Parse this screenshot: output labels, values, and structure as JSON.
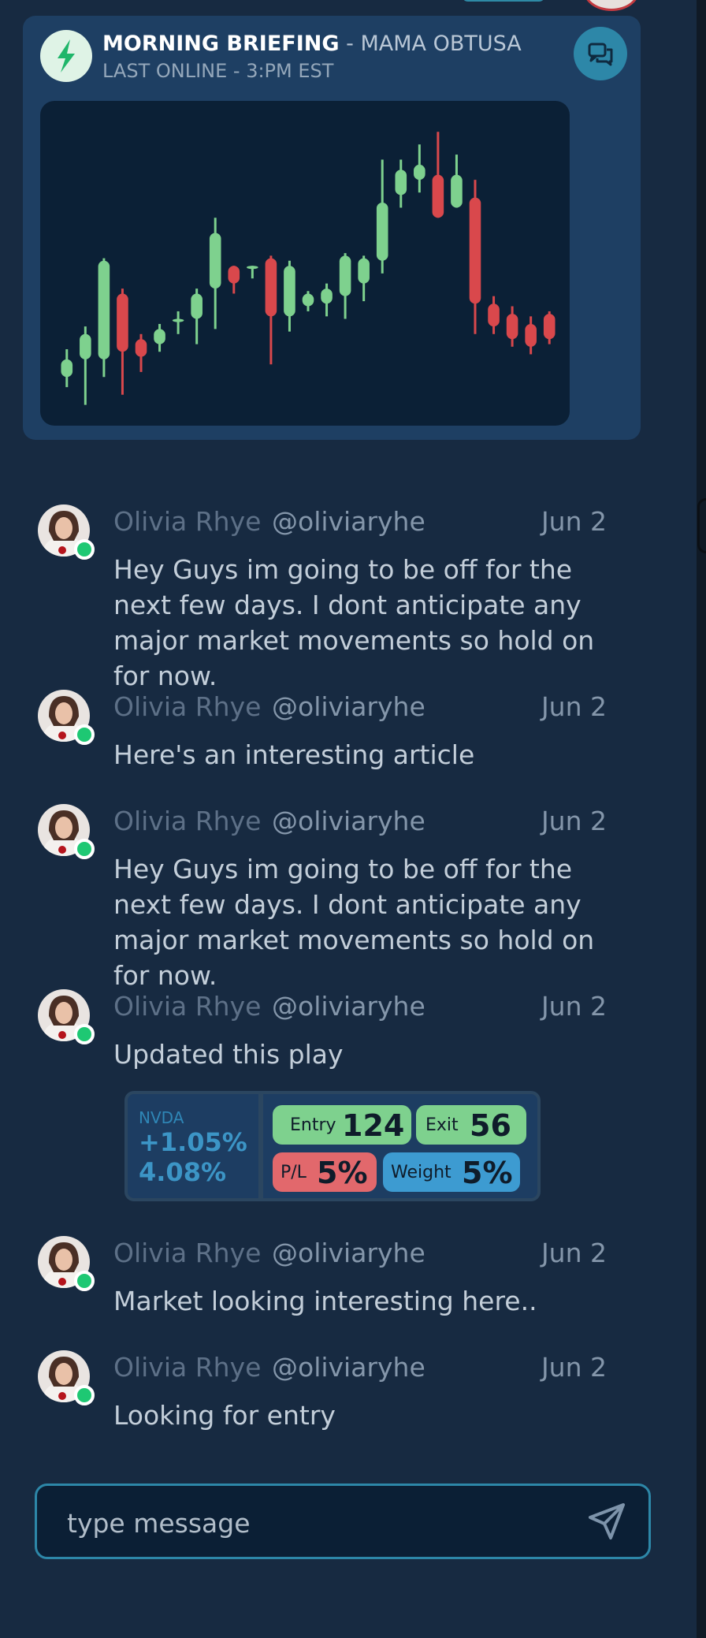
{
  "briefing": {
    "title": "MORNING BRIEFING",
    "separator": " - ",
    "author": "MAMA OBTUSA",
    "last_online": "LAST ONLINE - 3:PM EST",
    "icons": {
      "logo": "lightning-bolt-icon",
      "chat": "chat-bubbles-icon"
    },
    "colors": {
      "up": "#7ed18e",
      "down": "#d9484c",
      "panel": "#0b2036"
    }
  },
  "chart_data": {
    "type": "candlestick",
    "candles": [
      {
        "o": 5,
        "c": 12,
        "h": 16,
        "l": 1
      },
      {
        "o": 12,
        "c": 22,
        "h": 25,
        "l": -6
      },
      {
        "o": 12,
        "c": 51,
        "h": 52,
        "l": 5
      },
      {
        "o": 38,
        "c": 15,
        "h": 40,
        "l": -2
      },
      {
        "o": 20,
        "c": 13,
        "h": 22,
        "l": 7
      },
      {
        "o": 18,
        "c": 24,
        "h": 26,
        "l": 15
      },
      {
        "o": 28,
        "c": 28,
        "h": 31,
        "l": 22
      },
      {
        "o": 28,
        "c": 38,
        "h": 40,
        "l": 18
      },
      {
        "o": 40,
        "c": 62,
        "h": 68,
        "l": 24
      },
      {
        "o": 49,
        "c": 42,
        "h": 49,
        "l": 38
      },
      {
        "o": 49,
        "c": 49,
        "h": 49,
        "l": 44
      },
      {
        "o": 52,
        "c": 29,
        "h": 53,
        "l": 10
      },
      {
        "o": 29,
        "c": 49,
        "h": 51,
        "l": 23
      },
      {
        "o": 33,
        "c": 38,
        "h": 39,
        "l": 31
      },
      {
        "o": 34,
        "c": 40,
        "h": 42,
        "l": 29
      },
      {
        "o": 37,
        "c": 53,
        "h": 54,
        "l": 28
      },
      {
        "o": 42,
        "c": 52,
        "h": 53,
        "l": 35
      },
      {
        "o": 51,
        "c": 74,
        "h": 91,
        "l": 46
      },
      {
        "o": 77,
        "c": 87,
        "h": 91,
        "l": 72
      },
      {
        "o": 83,
        "c": 89,
        "h": 97,
        "l": 78
      },
      {
        "o": 85,
        "c": 68,
        "h": 102,
        "l": 68
      },
      {
        "o": 72,
        "c": 85,
        "h": 93,
        "l": 72
      },
      {
        "o": 76,
        "c": 34,
        "h": 83,
        "l": 22
      },
      {
        "o": 34,
        "c": 25,
        "h": 37,
        "l": 22
      },
      {
        "o": 30,
        "c": 20,
        "h": 33,
        "l": 17
      },
      {
        "o": 26,
        "c": 17,
        "h": 29,
        "l": 14
      },
      {
        "o": 30,
        "c": 20,
        "h": 31,
        "l": 18
      }
    ],
    "ylim": [
      -8,
      108
    ],
    "grid": false
  },
  "messages": [
    {
      "name": "Olivia Rhye",
      "handle": "@oliviaryhe",
      "date": "Jun 2",
      "text": "Hey Guys im going to be off for the next few days. I dont anticipate any major market movements so hold on for now."
    },
    {
      "name": "Olivia Rhye",
      "handle": "@oliviaryhe",
      "date": "Jun 2",
      "text": "Here's an interesting article"
    },
    {
      "name": "Olivia Rhye",
      "handle": "@oliviaryhe",
      "date": "Jun 2",
      "text": "Hey Guys im going to be off for the next few days. I dont anticipate any major market movements so hold on for now."
    },
    {
      "name": "Olivia Rhye",
      "handle": "@oliviaryhe",
      "date": "Jun 2",
      "text": "Updated this play"
    },
    {
      "name": "Olivia Rhye",
      "handle": "@oliviaryhe",
      "date": "Jun 2",
      "text": "Market looking interesting here.."
    },
    {
      "name": "Olivia Rhye",
      "handle": "@oliviaryhe",
      "date": "Jun 2",
      "text": "Looking for entry"
    }
  ],
  "trade": {
    "ticker": "NVDA",
    "change": "+1.05%",
    "percent": "4.08%",
    "entry_label": "Entry",
    "entry_value": "124",
    "exit_label": "Exit",
    "exit_value": "56",
    "pl_label": "P/L",
    "pl_value": "5%",
    "weight_label": "Weight",
    "weight_value": "5%"
  },
  "composer": {
    "placeholder": "type message",
    "send_icon": "send-icon"
  }
}
